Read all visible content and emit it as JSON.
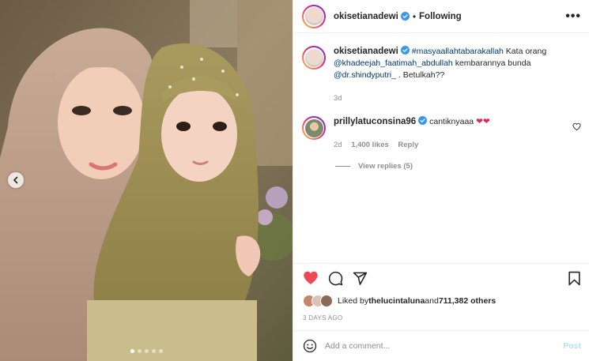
{
  "post": {
    "username": "okisetianadewi",
    "follow_state": "Following",
    "separator": "•",
    "more_icon": "more-horizontal-icon",
    "verified_color": "#3897f0"
  },
  "caption": {
    "username": "okisetianadewi",
    "hashtag": "#masyaallahtabarakallah",
    "text1": " Kata orang ",
    "mention1": "@khadeejah_faatimah_abdullah",
    "text2": " kembarannya bunda ",
    "mention2": "@dr.shindyputri_",
    "text3": " . Betulkah??",
    "age": "3d"
  },
  "comment": {
    "username": "prillylatuconsina96",
    "text": "cantiknyaaa",
    "emoji": "❤❤",
    "age": "2d",
    "likes": "1,400 likes",
    "reply_label": "Reply",
    "view_replies": "View replies (5)"
  },
  "likes_line": {
    "prefix": "Liked by ",
    "user": "thelucintaluna",
    "middle": " and ",
    "count": "711,382 others"
  },
  "timestamp": "3 DAYS AGO",
  "add_comment": {
    "placeholder": "Add a comment...",
    "post_label": "Post"
  },
  "carousel": {
    "total": 5,
    "active_index": 0
  },
  "colors": {
    "like_red": "#ed4956",
    "link_blue": "#00376b",
    "post_disabled": "#b2dffc"
  }
}
